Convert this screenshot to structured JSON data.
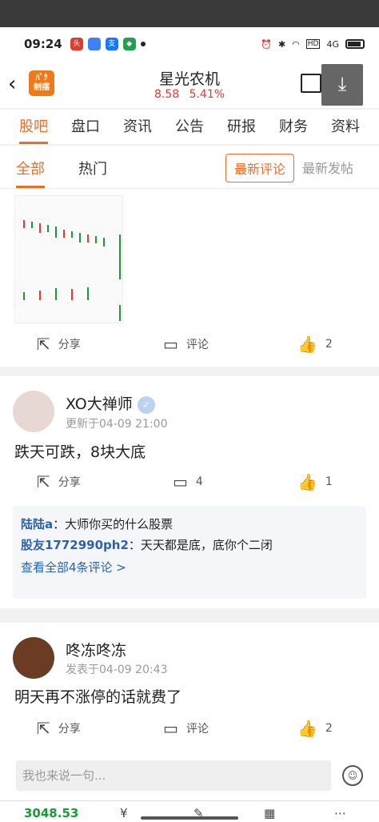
{
  "status": {
    "time": "09:24",
    "network": "4G"
  },
  "stock": {
    "name": "星光农机",
    "price": "8.58",
    "change": "5.41%"
  },
  "tabs": [
    "股吧",
    "盘口",
    "资讯",
    "公告",
    "研报",
    "财务",
    "资料"
  ],
  "subtabs": {
    "all": "全部",
    "hot": "热门"
  },
  "sort": {
    "latest_comment": "最新评论",
    "latest_post": "最新发帖"
  },
  "posts": [
    {
      "share": "分享",
      "comment": "评论",
      "likes": "2"
    },
    {
      "user": "XO大禅师",
      "meta": "更新于04-09 21:00",
      "content": "跌天可跌，8块大底",
      "share": "分享",
      "comments": "4",
      "likes": "1",
      "replies": [
        {
          "user": "陆陆a",
          "text": "：大师你买的什么股票"
        },
        {
          "user": "股友1772990ph2",
          "text": "：天天都是底，底你个二闭"
        }
      ],
      "more": "查看全部4条评论 >"
    },
    {
      "user": "咚冻咚冻",
      "meta": "发表于04-09 20:43",
      "content": "明天再不涨停的话就费了",
      "share": "分享",
      "comment": "评论",
      "likes": "2"
    }
  ],
  "input": {
    "placeholder": "我也来说一句..."
  },
  "bottom": {
    "index": "3048.53"
  }
}
